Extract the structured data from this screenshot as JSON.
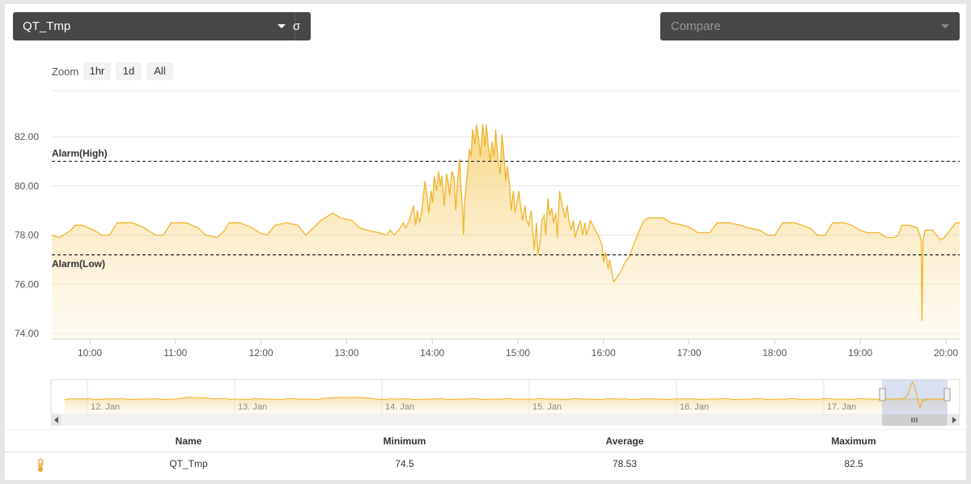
{
  "selector": {
    "value": "QT_Tmp",
    "sigma_label": "σ"
  },
  "compare": {
    "placeholder": "Compare"
  },
  "zoom": {
    "label": "Zoom",
    "buttons": [
      "1hr",
      "1d",
      "All"
    ]
  },
  "chart_data": {
    "type": "area",
    "series": [
      {
        "name": "QT_Tmp",
        "color": "#f0b429"
      }
    ],
    "x_ticks": [
      "10:00",
      "11:00",
      "12:00",
      "13:00",
      "14:00",
      "15:00",
      "16:00",
      "17:00",
      "18:00",
      "19:00",
      "20:00"
    ],
    "y_ticks": [
      "74.00",
      "76.00",
      "78.00",
      "80.00",
      "82.00"
    ],
    "ylim": [
      74,
      82
    ],
    "x_range_hours": [
      9.55,
      20.1
    ],
    "points": [
      [
        9.55,
        78.0
      ],
      [
        9.65,
        77.9
      ],
      [
        9.8,
        78.2
      ],
      [
        9.85,
        78.4
      ],
      [
        9.95,
        78.4
      ],
      [
        10.1,
        78.2
      ],
      [
        10.2,
        78.0
      ],
      [
        10.3,
        78.0
      ],
      [
        10.4,
        78.5
      ],
      [
        10.6,
        78.5
      ],
      [
        10.75,
        78.3
      ],
      [
        10.9,
        78.0
      ],
      [
        11.0,
        78.0
      ],
      [
        11.1,
        78.5
      ],
      [
        11.3,
        78.5
      ],
      [
        11.45,
        78.3
      ],
      [
        11.55,
        78.0
      ],
      [
        11.7,
        77.9
      ],
      [
        11.8,
        78.2
      ],
      [
        11.85,
        78.5
      ],
      [
        12.0,
        78.5
      ],
      [
        12.15,
        78.3
      ],
      [
        12.25,
        78.1
      ],
      [
        12.35,
        78.0
      ],
      [
        12.45,
        78.4
      ],
      [
        12.6,
        78.5
      ],
      [
        12.75,
        78.4
      ],
      [
        12.85,
        78.0
      ],
      [
        12.95,
        78.3
      ],
      [
        13.05,
        78.6
      ],
      [
        13.15,
        78.8
      ],
      [
        13.2,
        78.9
      ],
      [
        13.3,
        78.7
      ],
      [
        13.45,
        78.6
      ],
      [
        13.55,
        78.3
      ],
      [
        13.65,
        78.2
      ],
      [
        13.8,
        78.1
      ],
      [
        13.9,
        78.0
      ],
      [
        13.95,
        78.2
      ],
      [
        14.0,
        78.0
      ],
      [
        14.08,
        78.3
      ],
      [
        14.12,
        78.5
      ],
      [
        14.15,
        78.3
      ],
      [
        14.2,
        78.6
      ],
      [
        14.25,
        79.2
      ],
      [
        14.28,
        78.4
      ],
      [
        14.3,
        79.0
      ],
      [
        14.33,
        78.5
      ],
      [
        14.35,
        78.8
      ],
      [
        14.38,
        79.6
      ],
      [
        14.4,
        80.2
      ],
      [
        14.43,
        79.5
      ],
      [
        14.45,
        78.9
      ],
      [
        14.48,
        79.8
      ],
      [
        14.5,
        79.3
      ],
      [
        14.52,
        80.4
      ],
      [
        14.55,
        79.8
      ],
      [
        14.58,
        80.6
      ],
      [
        14.6,
        80.0
      ],
      [
        14.62,
        80.4
      ],
      [
        14.65,
        79.2
      ],
      [
        14.68,
        80.5
      ],
      [
        14.7,
        80.2
      ],
      [
        14.72,
        79.6
      ],
      [
        14.75,
        80.6
      ],
      [
        14.78,
        80.3
      ],
      [
        14.8,
        79.0
      ],
      [
        14.82,
        80.0
      ],
      [
        14.85,
        81.1
      ],
      [
        14.87,
        79.8
      ],
      [
        14.89,
        79.0
      ],
      [
        14.9,
        78.0
      ],
      [
        14.92,
        79.5
      ],
      [
        14.95,
        80.5
      ],
      [
        14.98,
        81.5
      ],
      [
        15.0,
        81.2
      ],
      [
        15.02,
        82.3
      ],
      [
        15.05,
        81.7
      ],
      [
        15.07,
        82.5
      ],
      [
        15.1,
        81.9
      ],
      [
        15.12,
        81.2
      ],
      [
        15.15,
        82.5
      ],
      [
        15.18,
        81.6
      ],
      [
        15.2,
        82.5
      ],
      [
        15.22,
        81.7
      ],
      [
        15.25,
        81.0
      ],
      [
        15.27,
        81.8
      ],
      [
        15.3,
        81.2
      ],
      [
        15.32,
        82.3
      ],
      [
        15.35,
        81.0
      ],
      [
        15.38,
        80.5
      ],
      [
        15.4,
        82.1
      ],
      [
        15.42,
        81.5
      ],
      [
        15.45,
        80.2
      ],
      [
        15.47,
        80.8
      ],
      [
        15.5,
        80.0
      ],
      [
        15.52,
        79.0
      ],
      [
        15.55,
        79.8
      ],
      [
        15.57,
        78.9
      ],
      [
        15.6,
        79.4
      ],
      [
        15.62,
        79.8
      ],
      [
        15.65,
        79.0
      ],
      [
        15.67,
        78.6
      ],
      [
        15.7,
        79.2
      ],
      [
        15.72,
        78.6
      ],
      [
        15.75,
        78.4
      ],
      [
        15.78,
        79.0
      ],
      [
        15.8,
        78.2
      ],
      [
        15.82,
        77.4
      ],
      [
        15.85,
        78.5
      ],
      [
        15.87,
        77.2
      ],
      [
        15.9,
        77.8
      ],
      [
        15.92,
        78.6
      ],
      [
        15.95,
        78.8
      ],
      [
        15.97,
        78.0
      ],
      [
        16.0,
        79.5
      ],
      [
        16.02,
        78.8
      ],
      [
        16.05,
        79.1
      ],
      [
        16.07,
        78.5
      ],
      [
        16.1,
        78.9
      ],
      [
        16.12,
        77.9
      ],
      [
        16.15,
        79.8
      ],
      [
        16.18,
        79.3
      ],
      [
        16.2,
        79.0
      ],
      [
        16.22,
        78.7
      ],
      [
        16.25,
        79.2
      ],
      [
        16.27,
        78.6
      ],
      [
        16.3,
        78.2
      ],
      [
        16.33,
        78.6
      ],
      [
        16.35,
        77.9
      ],
      [
        16.4,
        78.4
      ],
      [
        16.42,
        78.6
      ],
      [
        16.45,
        78.0
      ],
      [
        16.48,
        78.5
      ],
      [
        16.5,
        78.0
      ],
      [
        16.55,
        78.6
      ],
      [
        16.6,
        78.3
      ],
      [
        16.65,
        78.0
      ],
      [
        16.7,
        77.6
      ],
      [
        16.72,
        76.9
      ],
      [
        16.75,
        77.3
      ],
      [
        16.78,
        76.6
      ],
      [
        16.8,
        77.0
      ],
      [
        16.83,
        76.5
      ],
      [
        16.85,
        76.1
      ],
      [
        16.88,
        76.2
      ],
      [
        16.92,
        76.4
      ],
      [
        16.96,
        76.6
      ],
      [
        17.0,
        76.9
      ],
      [
        17.05,
        77.1
      ],
      [
        17.1,
        77.5
      ],
      [
        17.15,
        77.9
      ],
      [
        17.2,
        78.3
      ],
      [
        17.25,
        78.6
      ],
      [
        17.3,
        78.7
      ],
      [
        17.5,
        78.7
      ],
      [
        17.6,
        78.5
      ],
      [
        17.75,
        78.4
      ],
      [
        17.85,
        78.3
      ],
      [
        17.95,
        78.1
      ],
      [
        18.1,
        78.1
      ],
      [
        18.2,
        78.5
      ],
      [
        18.35,
        78.5
      ],
      [
        18.5,
        78.4
      ],
      [
        18.6,
        78.3
      ],
      [
        18.75,
        78.2
      ],
      [
        18.85,
        78.0
      ],
      [
        18.95,
        78.0
      ],
      [
        19.05,
        78.5
      ],
      [
        19.2,
        78.5
      ],
      [
        19.3,
        78.4
      ],
      [
        19.4,
        78.3
      ],
      [
        19.5,
        78.0
      ],
      [
        19.6,
        78.0
      ],
      [
        19.7,
        78.5
      ],
      [
        19.85,
        78.5
      ],
      [
        19.95,
        78.4
      ],
      [
        20.05,
        78.2
      ],
      [
        20.15,
        78.1
      ],
      [
        20.3,
        78.1
      ],
      [
        20.4,
        77.9
      ],
      [
        20.5,
        77.9
      ],
      [
        20.55,
        78.0
      ],
      [
        20.6,
        78.4
      ],
      [
        20.7,
        78.4
      ],
      [
        20.8,
        78.3
      ],
      [
        20.85,
        77.8
      ],
      [
        20.86,
        74.5
      ],
      [
        20.875,
        77.8
      ],
      [
        20.9,
        78.2
      ],
      [
        21.0,
        78.2
      ],
      [
        21.05,
        78.0
      ],
      [
        21.1,
        77.8
      ],
      [
        21.15,
        77.9
      ],
      [
        21.2,
        78.1
      ],
      [
        21.25,
        78.3
      ],
      [
        21.3,
        78.5
      ],
      [
        21.35,
        78.5
      ]
    ],
    "alarm_high": {
      "label": "Alarm(High)",
      "value": 81.0
    },
    "alarm_low": {
      "label": "Alarm(Low)",
      "value": 77.2
    },
    "navigator": {
      "labels": [
        "12. Jan",
        "13. Jan",
        "14. Jan",
        "15. Jan",
        "16. Jan",
        "17. Jan"
      ]
    }
  },
  "stats": {
    "headers": {
      "name": "Name",
      "min": "Minimum",
      "avg": "Average",
      "max": "Maximum"
    },
    "row": {
      "name": "QT_Tmp",
      "min": "74.5",
      "avg": "78.53",
      "max": "82.5",
      "icon": "thermometer-icon"
    }
  },
  "colors": {
    "series": "#f0b429",
    "toolbar": "#474747"
  }
}
